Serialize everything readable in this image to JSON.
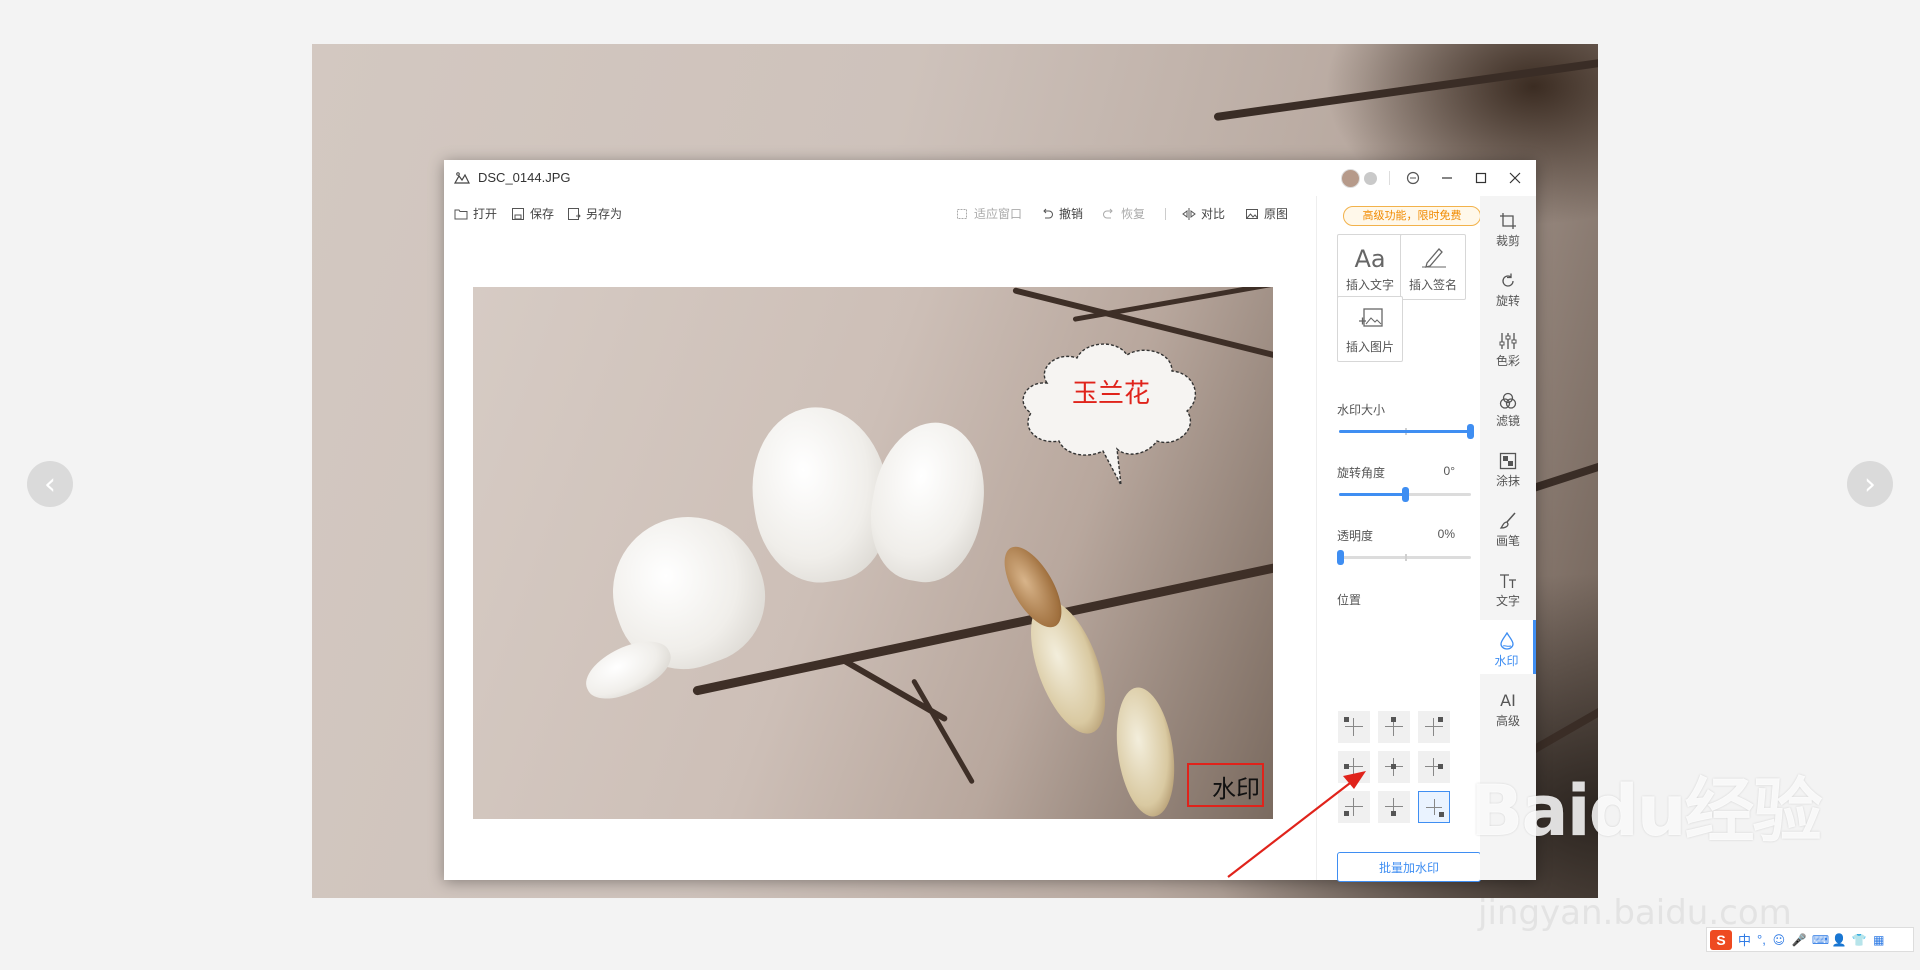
{
  "window": {
    "title": "DSC_0144.JPG"
  },
  "toolbar": {
    "open": "打开",
    "save": "保存",
    "save_as": "另存为",
    "fit_window": "适应窗口",
    "undo": "撤销",
    "redo": "恢复",
    "compare": "对比",
    "original": "原图"
  },
  "canvas": {
    "bubble_text": "玉兰花",
    "watermark_text": "水印"
  },
  "panel": {
    "promo": "高级功能，限时免费",
    "insert_text_glyph": "Aa",
    "insert_text": "插入文字",
    "insert_signature": "插入签名",
    "insert_image": "插入图片",
    "size_label": "水印大小",
    "size_level": 1.0,
    "rotation_label": "旋转角度",
    "rotation_value": "0°",
    "rotation_level": 0.5,
    "opacity_label": "透明度",
    "opacity_value": "0%",
    "opacity_level": 0.0,
    "position_label": "位置",
    "position_selected": "bottom-right",
    "batch_button": "批量加水印"
  },
  "rightbar": {
    "items": [
      {
        "label": "裁剪",
        "icon": "crop-icon"
      },
      {
        "label": "旋转",
        "icon": "rotate-icon"
      },
      {
        "label": "色彩",
        "icon": "color-icon"
      },
      {
        "label": "滤镜",
        "icon": "filter-icon"
      },
      {
        "label": "涂抹",
        "icon": "mosaic-icon"
      },
      {
        "label": "画笔",
        "icon": "brush-icon"
      },
      {
        "label": "文字",
        "icon": "text-icon"
      },
      {
        "label": "水印",
        "icon": "watermark-icon"
      },
      {
        "label": "高级",
        "icon": "ai-icon",
        "glyph": "AI"
      }
    ],
    "active": "水印"
  },
  "overlay": {
    "baidu_logo": "Baidu经验",
    "baidu_url": "jingyan.baidu.com"
  },
  "ime": {
    "logo": "S",
    "mode": "中",
    "punct": "°,"
  },
  "colors": {
    "accent": "#3f8ef2",
    "annotation_red": "#e0231b",
    "promo_orange": "#f08a00"
  }
}
